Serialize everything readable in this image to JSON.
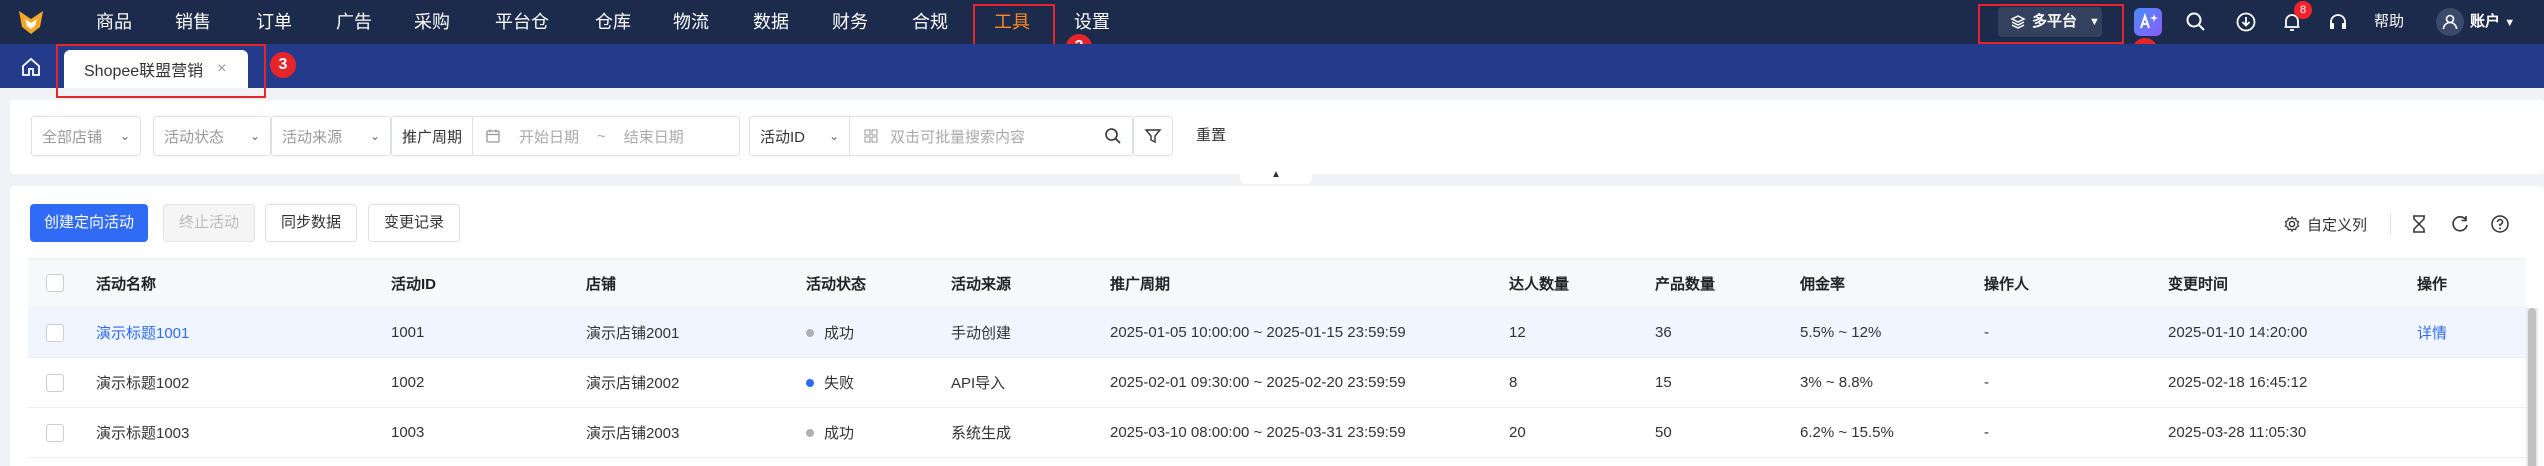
{
  "nav": {
    "items": [
      {
        "label": "商品",
        "name": "nav-item-products"
      },
      {
        "label": "销售",
        "name": "nav-item-sales"
      },
      {
        "label": "订单",
        "name": "nav-item-orders"
      },
      {
        "label": "广告",
        "name": "nav-item-ads"
      },
      {
        "label": "采购",
        "name": "nav-item-purchase"
      },
      {
        "label": "平台仓",
        "name": "nav-item-platform-warehouse"
      },
      {
        "label": "仓库",
        "name": "nav-item-warehouse"
      },
      {
        "label": "物流",
        "name": "nav-item-logistics"
      },
      {
        "label": "数据",
        "name": "nav-item-data"
      },
      {
        "label": "财务",
        "name": "nav-item-finance"
      },
      {
        "label": "合规",
        "name": "nav-item-compliance"
      },
      {
        "label": "工具",
        "name": "nav-item-tools",
        "active": true
      },
      {
        "label": "设置",
        "name": "nav-item-settings"
      }
    ],
    "platform_label": "多平台",
    "notification_count": "8",
    "help_label": "帮助",
    "account_label": "账户",
    "annotations": [
      "1",
      "2",
      "3"
    ],
    "active_color": "#ff8a1f",
    "bg_color": "#1c2a4b"
  },
  "tabs": [
    {
      "label": "Shopee联盟营销",
      "close": "×"
    }
  ],
  "filters": {
    "shop": "全部店铺",
    "status": "活动状态",
    "source": "活动来源",
    "period_label": "推广周期",
    "start_placeholder": "开始日期",
    "range_sep": "~",
    "end_placeholder": "结束日期",
    "id_select": "活动ID",
    "search_placeholder": "双击可批量搜索内容",
    "reset": "重置"
  },
  "toolbar": {
    "create": "创建定向活动",
    "stop": "终止活动",
    "sync": "同步数据",
    "history": "变更记录",
    "custom_columns": "自定义列"
  },
  "table": {
    "columns": [
      "活动名称",
      "活动ID",
      "店铺",
      "活动状态",
      "活动来源",
      "推广周期",
      "达人数量",
      "产品数量",
      "佣金率",
      "操作人",
      "变更时间",
      "操作"
    ],
    "rows": [
      {
        "name": "演示标题1001",
        "id": "1001",
        "shop": "演示店铺2001",
        "status": "成功",
        "status_color": "#b0b0b0",
        "source": "手动创建",
        "period": "2025-01-05 10:00:00 ~ 2025-01-15 23:59:59",
        "creators": "12",
        "products": "36",
        "commission": "5.5% ~ 12%",
        "operator": "-",
        "changed": "2025-01-10 14:20:00",
        "action": "详情"
      },
      {
        "name": "演示标题1002",
        "id": "1002",
        "shop": "演示店铺2002",
        "status": "失败",
        "status_color": "#2f6bf5",
        "source": "API导入",
        "period": "2025-02-01 09:30:00 ~ 2025-02-20 23:59:59",
        "creators": "8",
        "products": "15",
        "commission": "3% ~ 8.8%",
        "operator": "-",
        "changed": "2025-02-18 16:45:12",
        "action": ""
      },
      {
        "name": "演示标题1003",
        "id": "1003",
        "shop": "演示店铺2003",
        "status": "成功",
        "status_color": "#b0b0b0",
        "source": "系统生成",
        "period": "2025-03-10 08:00:00 ~ 2025-03-31 23:59:59",
        "creators": "20",
        "products": "50",
        "commission": "6.2% ~ 15.5%",
        "operator": "-",
        "changed": "2025-03-28 11:05:30",
        "action": ""
      }
    ]
  }
}
